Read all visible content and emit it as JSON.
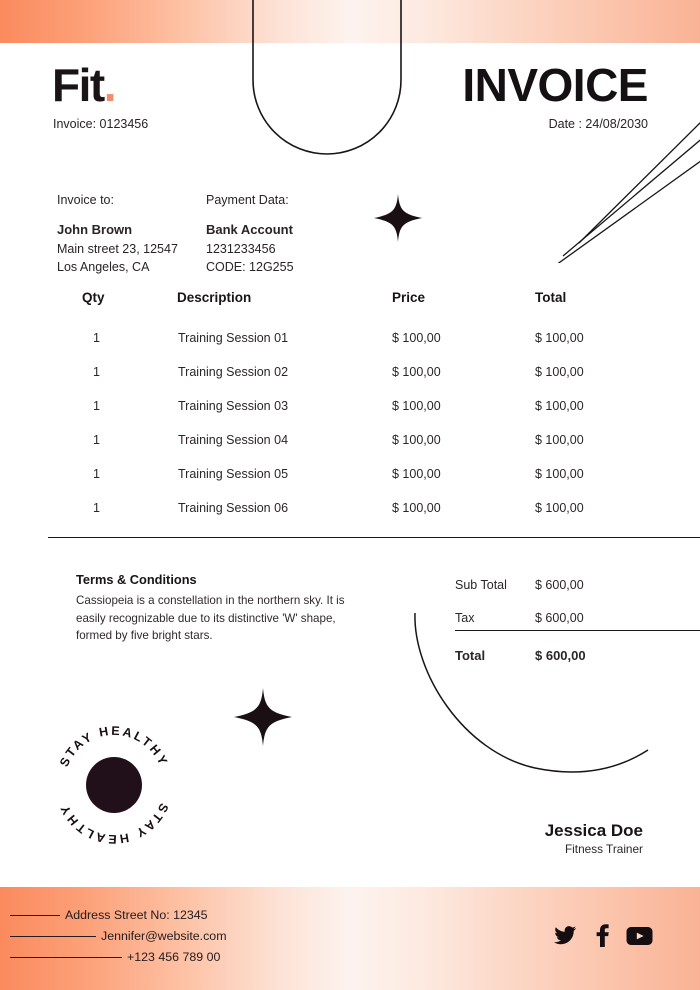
{
  "brand": {
    "logo_text": "Fit",
    "logo_dot": ".",
    "accent_color": "#ef8e6e",
    "band_color_left": "#fb8a5e",
    "band_color_mid": "#fdf3ee",
    "band_color_right": "#fab295"
  },
  "header": {
    "title": "INVOICE",
    "invoice_number_label": "Invoice: 0123456",
    "date_label": "Date : 24/08/2030"
  },
  "bill_to": {
    "label": "Invoice to:",
    "name": "John Brown",
    "address_line1": "Main street 23, 12547",
    "address_line2": "Los Angeles, CA"
  },
  "payment": {
    "label": "Payment Data:",
    "title": "Bank Account",
    "account_number": "1231233456",
    "code": "CODE: 12G255"
  },
  "table": {
    "columns": [
      "Qty",
      "Description",
      "Price",
      "Total"
    ],
    "rows": [
      {
        "qty": "1",
        "description": "Training Session 01",
        "price": "$ 100,00",
        "total": "$ 100,00"
      },
      {
        "qty": "1",
        "description": "Training Session 02",
        "price": "$ 100,00",
        "total": "$ 100,00"
      },
      {
        "qty": "1",
        "description": "Training Session 03",
        "price": "$ 100,00",
        "total": "$ 100,00"
      },
      {
        "qty": "1",
        "description": "Training Session 04",
        "price": "$ 100,00",
        "total": "$ 100,00"
      },
      {
        "qty": "1",
        "description": "Training Session 05",
        "price": "$ 100,00",
        "total": "$ 100,00"
      },
      {
        "qty": "1",
        "description": "Training Session 06",
        "price": "$ 100,00",
        "total": "$ 100,00"
      }
    ]
  },
  "terms": {
    "title": "Terms & Conditions",
    "body": "Cassiopeia is a constellation in the northern sky. It is easily recognizable due to its distinctive 'W' shape, formed by five bright stars."
  },
  "totals": {
    "subtotal_label": "Sub Total",
    "subtotal_value": "$ 600,00",
    "tax_label": "Tax",
    "tax_value": "$ 600,00",
    "total_label": "Total",
    "total_value": "$ 600,00"
  },
  "badge": {
    "text_top": "STAY HEALTHY",
    "text_bottom": "STAY HEALTHY"
  },
  "signature": {
    "name": "Jessica Doe",
    "role": "Fitness Trainer"
  },
  "footer": {
    "address": "Address Street No: 12345",
    "email": "Jennifer@website.com",
    "phone": "+123 456 789 00",
    "socials": [
      "twitter-icon",
      "facebook-icon",
      "youtube-icon"
    ]
  }
}
